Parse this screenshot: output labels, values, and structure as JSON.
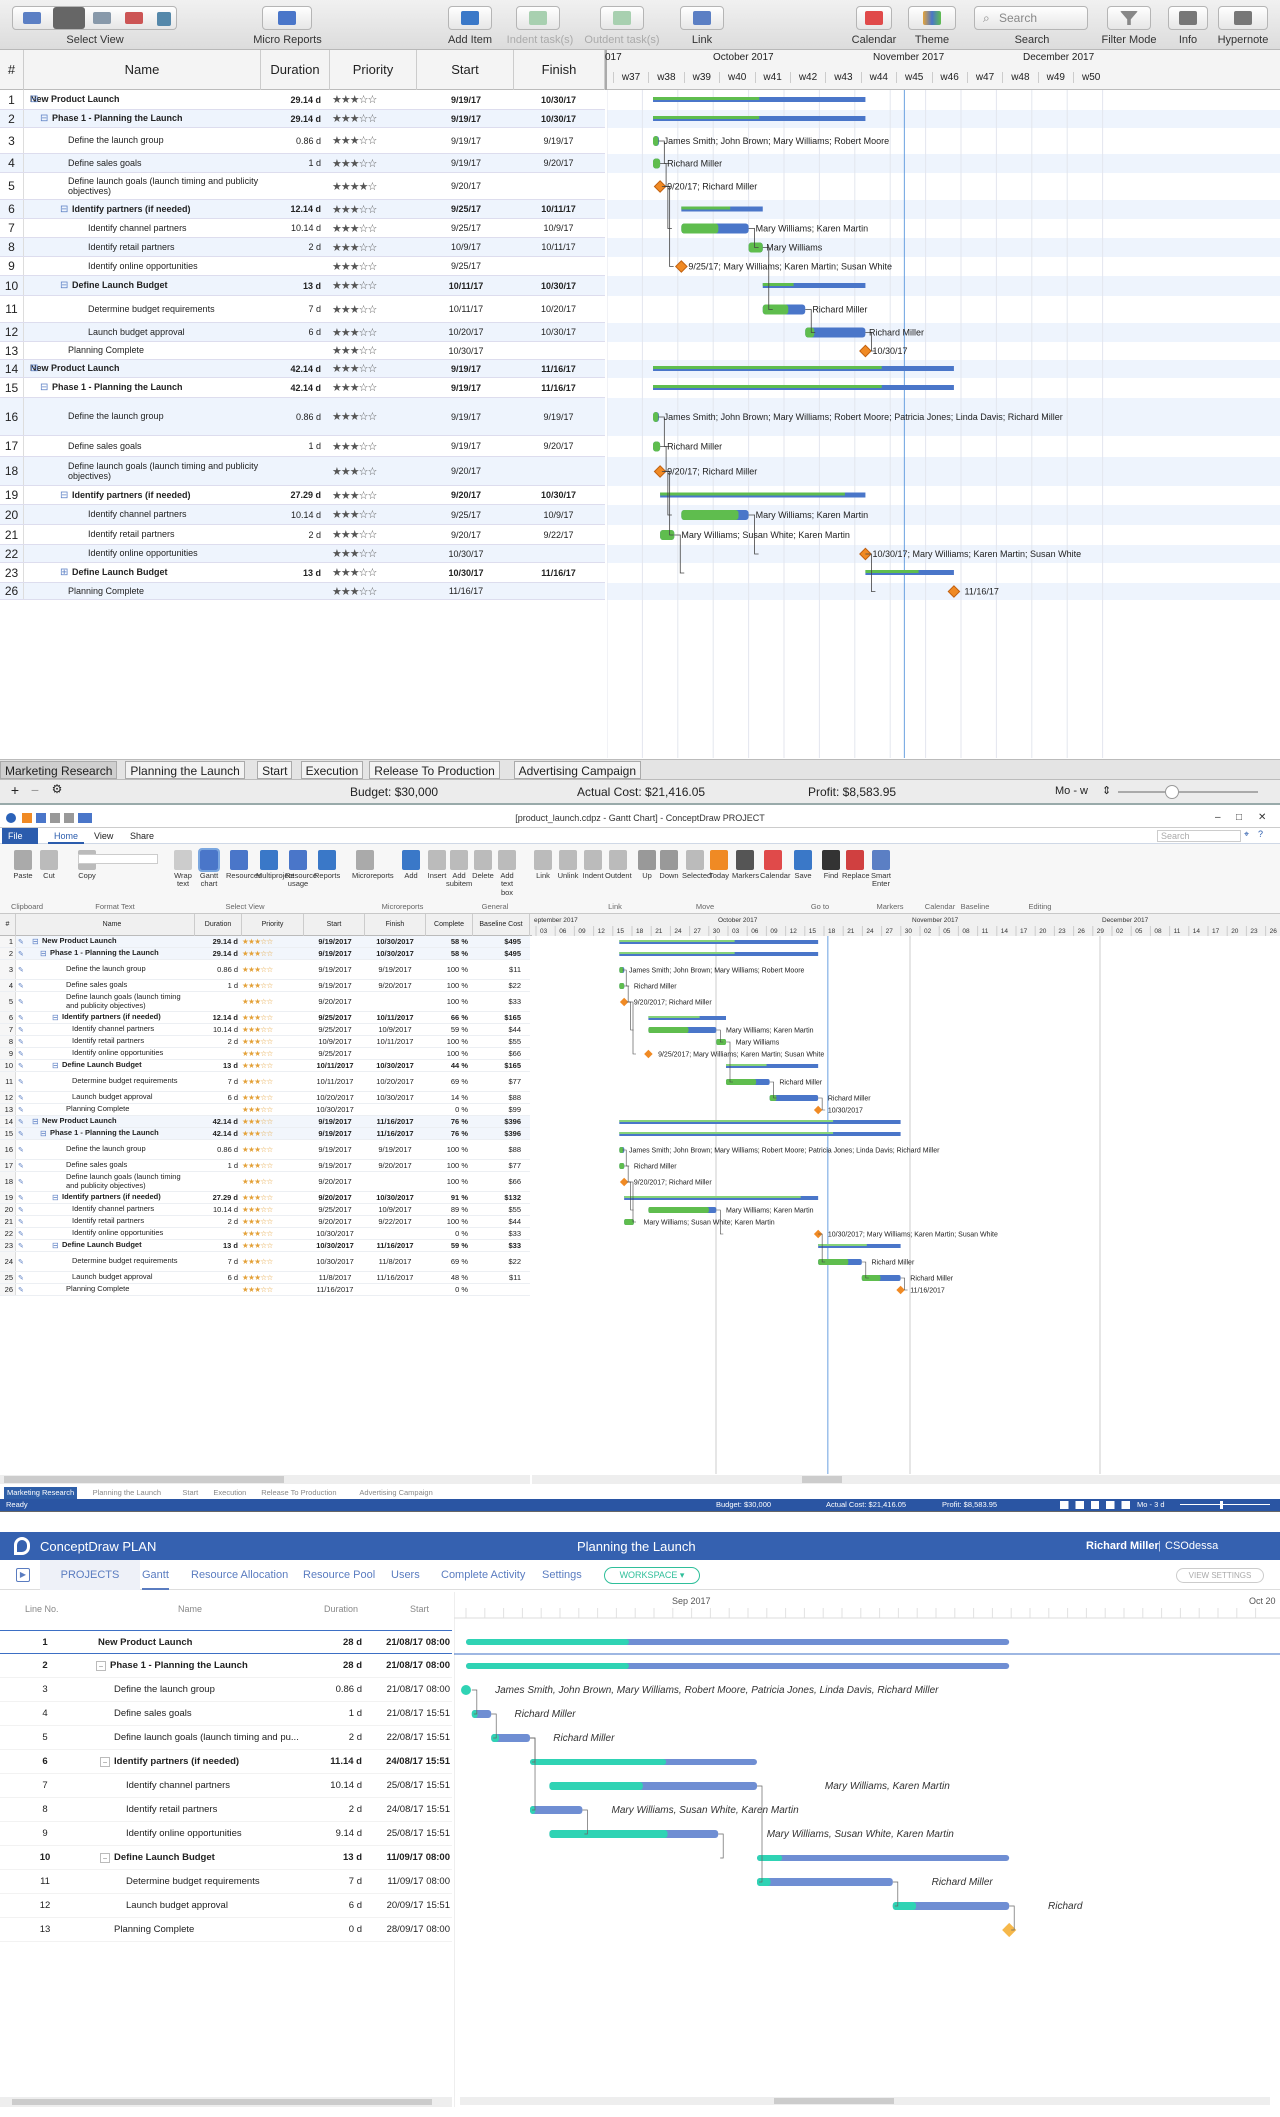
{
  "mac": {
    "toolbar": {
      "select_view": "Select View",
      "micro_reports": "Micro Reports",
      "add_item": "Add Item",
      "indent": "Indent task(s)",
      "outdent": "Outdent task(s)",
      "link": "Link",
      "calendar": "Calendar",
      "theme": "Theme",
      "search": "Search",
      "search_placeholder": "Search",
      "filter_mode": "Filter Mode",
      "info": "Info",
      "hypernote": "Hypernote"
    },
    "columns": {
      "num": "#",
      "name": "Name",
      "duration": "Duration",
      "priority": "Priority",
      "start": "Start",
      "finish": "Finish"
    },
    "months": [
      "017",
      "October 2017",
      "November 2017",
      "December 2017"
    ],
    "weeks": [
      "w37",
      "w38",
      "w39",
      "w40",
      "w41",
      "w42",
      "w43",
      "w44",
      "w45",
      "w46",
      "w47",
      "w48",
      "w49",
      "w50"
    ],
    "rows": [
      {
        "n": "1",
        "name": "New Product Launch",
        "dur": "29.14 d",
        "stars": "★★★☆☆",
        "start": "9/19/17",
        "finish": "10/30/17",
        "lvl": 0,
        "sum": true
      },
      {
        "n": "2",
        "name": "Phase 1 - Planning the Launch",
        "dur": "29.14 d",
        "stars": "★★★☆☆",
        "start": "9/19/17",
        "finish": "10/30/17",
        "lvl": 1,
        "sum": true
      },
      {
        "n": "3",
        "name": "Define the launch group",
        "dur": "0.86 d",
        "stars": "★★★☆☆",
        "start": "9/19/17",
        "finish": "9/19/17",
        "lvl": 2
      },
      {
        "n": "4",
        "name": "Define sales goals",
        "dur": "1 d",
        "stars": "★★★☆☆",
        "start": "9/19/17",
        "finish": "9/20/17",
        "lvl": 2
      },
      {
        "n": "5",
        "name": "Define launch goals (launch timing and publicity objectives)",
        "dur": "",
        "stars": "★★★★☆",
        "start": "9/20/17",
        "finish": "",
        "lvl": 2
      },
      {
        "n": "6",
        "name": "Identify partners (if needed)",
        "dur": "12.14 d",
        "stars": "★★★☆☆",
        "start": "9/25/17",
        "finish": "10/11/17",
        "lvl": 2,
        "sum": true
      },
      {
        "n": "7",
        "name": "Identify channel partners",
        "dur": "10.14 d",
        "stars": "★★★☆☆",
        "start": "9/25/17",
        "finish": "10/9/17",
        "lvl": 3
      },
      {
        "n": "8",
        "name": "Identify retail partners",
        "dur": "2 d",
        "stars": "★★★☆☆",
        "start": "10/9/17",
        "finish": "10/11/17",
        "lvl": 3
      },
      {
        "n": "9",
        "name": "Identify online opportunities",
        "dur": "",
        "stars": "★★★☆☆",
        "start": "9/25/17",
        "finish": "",
        "lvl": 3
      },
      {
        "n": "10",
        "name": "Define Launch Budget",
        "dur": "13 d",
        "stars": "★★★☆☆",
        "start": "10/11/17",
        "finish": "10/30/17",
        "lvl": 2,
        "sum": true
      },
      {
        "n": "11",
        "name": "Determine budget requirements",
        "dur": "7 d",
        "stars": "★★★☆☆",
        "start": "10/11/17",
        "finish": "10/20/17",
        "lvl": 3
      },
      {
        "n": "12",
        "name": "Launch budget approval",
        "dur": "6 d",
        "stars": "★★★☆☆",
        "start": "10/20/17",
        "finish": "10/30/17",
        "lvl": 3
      },
      {
        "n": "13",
        "name": "Planning Complete",
        "dur": "",
        "stars": "★★★☆☆",
        "start": "10/30/17",
        "finish": "",
        "lvl": 2
      },
      {
        "n": "14",
        "name": "New Product Launch",
        "dur": "42.14 d",
        "stars": "★★★☆☆",
        "start": "9/19/17",
        "finish": "11/16/17",
        "lvl": 0,
        "sum": true
      },
      {
        "n": "15",
        "name": "Phase 1 - Planning the Launch",
        "dur": "42.14 d",
        "stars": "★★★☆☆",
        "start": "9/19/17",
        "finish": "11/16/17",
        "lvl": 1,
        "sum": true
      },
      {
        "n": "16",
        "name": "Define the launch group",
        "dur": "0.86 d",
        "stars": "★★★☆☆",
        "start": "9/19/17",
        "finish": "9/19/17",
        "lvl": 2
      },
      {
        "n": "17",
        "name": "Define sales goals",
        "dur": "1 d",
        "stars": "★★★☆☆",
        "start": "9/19/17",
        "finish": "9/20/17",
        "lvl": 2
      },
      {
        "n": "18",
        "name": "Define launch goals (launch timing and publicity objectives)",
        "dur": "",
        "stars": "★★★☆☆",
        "start": "9/20/17",
        "finish": "",
        "lvl": 2
      },
      {
        "n": "19",
        "name": "Identify partners (if needed)",
        "dur": "27.29 d",
        "stars": "★★★☆☆",
        "start": "9/20/17",
        "finish": "10/30/17",
        "lvl": 2,
        "sum": true
      },
      {
        "n": "20",
        "name": "Identify channel partners",
        "dur": "10.14 d",
        "stars": "★★★☆☆",
        "start": "9/25/17",
        "finish": "10/9/17",
        "lvl": 3
      },
      {
        "n": "21",
        "name": "Identify retail partners",
        "dur": "2 d",
        "stars": "★★★☆☆",
        "start": "9/20/17",
        "finish": "9/22/17",
        "lvl": 3
      },
      {
        "n": "22",
        "name": "Identify online opportunities",
        "dur": "",
        "stars": "★★★☆☆",
        "start": "10/30/17",
        "finish": "",
        "lvl": 3
      },
      {
        "n": "23",
        "name": "Define Launch Budget",
        "dur": "13 d",
        "stars": "★★★☆☆",
        "start": "10/30/17",
        "finish": "11/16/17",
        "lvl": 2,
        "sum": true,
        "collapsed": true
      },
      {
        "n": "26",
        "name": "Planning Complete",
        "dur": "",
        "stars": "★★★☆☆",
        "start": "11/16/17",
        "finish": "",
        "lvl": 2
      }
    ],
    "labels": [
      "James Smith; John Brown; Mary Williams; Robert Moore",
      "Richard Miller",
      "9/20/17; Richard Miller",
      "Mary Williams; Karen Martin",
      "Mary Williams",
      "9/25/17; Mary Williams; Karen Martin; Susan White",
      "Richard Miller",
      "Richard Miller",
      "10/30/17",
      "James Smith; John Brown; Mary Williams; Robert Moore; Patricia Jones; Linda Davis; Richard Miller",
      "Richard Miller",
      "9/20/17; Richard Miller",
      "Mary Williams; Karen Martin",
      "Mary Williams; Susan White; Karen Martin",
      "10/30/17; Mary Williams; Karen Martin; Susan White",
      "11/16/17"
    ],
    "tabs": [
      "Marketing Research",
      "Planning the Launch",
      "Start",
      "Execution",
      "Release To Production",
      "Advertising Campaign"
    ],
    "status": {
      "budget": "Budget: $30,000",
      "actual": "Actual Cost: $21,416.05",
      "profit": "Profit: $8,583.95",
      "zoom": "Mo - w"
    }
  },
  "win": {
    "title": "[product_launch.cdpz - Gantt Chart] - ConceptDraw PROJECT",
    "search_placeholder": "Search",
    "menu": [
      "File",
      "Home",
      "View",
      "Share"
    ],
    "ribbon": [
      "Paste",
      "Cut",
      "Copy",
      "Wrap text",
      "Gantt chart",
      "Resources",
      "Multiproject",
      "Resource usage",
      "Reports",
      "Microreports",
      "Add",
      "Insert",
      "Add subitem",
      "Delete",
      "Add text box",
      "Link",
      "Unlink",
      "Indent",
      "Outdent",
      "Up",
      "Down",
      "Selected",
      "Today",
      "Markers",
      "Calendar",
      "Save",
      "Find",
      "Replace",
      "Smart Enter"
    ],
    "groups": [
      "Clipboard",
      "Format Text",
      "Select View",
      "Microreports",
      "General",
      "Link",
      "Move",
      "Go to",
      "Markers",
      "Calendar",
      "Baseline",
      "Editing"
    ],
    "columns": [
      "#",
      "Name",
      "Duration",
      "Priority",
      "Start",
      "Finish",
      "Complete",
      "Baseline Cost"
    ],
    "months": [
      "eptember 2017",
      "October 2017",
      "November 2017",
      "December 2017"
    ],
    "days": [
      "03",
      "06",
      "09",
      "12",
      "15",
      "18",
      "21",
      "24",
      "27",
      "30",
      "03",
      "06",
      "09",
      "12",
      "15",
      "18",
      "21",
      "24",
      "27",
      "30",
      "02",
      "05",
      "08",
      "11",
      "14",
      "17",
      "20",
      "23",
      "26",
      "29",
      "02",
      "05",
      "08",
      "11",
      "14",
      "17",
      "20",
      "23",
      "26"
    ],
    "rows": [
      {
        "n": "1",
        "name": "New Product Launch",
        "dur": "29.14 d",
        "start": "9/19/2017",
        "finish": "10/30/2017",
        "comp": "58 %",
        "cost": "$495",
        "lvl": 0,
        "sum": true
      },
      {
        "n": "2",
        "name": "Phase 1 - Planning the Launch",
        "dur": "29.14 d",
        "start": "9/19/2017",
        "finish": "10/30/2017",
        "comp": "58 %",
        "cost": "$495",
        "lvl": 1,
        "sum": true
      },
      {
        "n": "3",
        "name": "Define the launch group",
        "dur": "0.86 d",
        "start": "9/19/2017",
        "finish": "9/19/2017",
        "comp": "100 %",
        "cost": "$11",
        "lvl": 2
      },
      {
        "n": "4",
        "name": "Define sales goals",
        "dur": "1 d",
        "start": "9/19/2017",
        "finish": "9/20/2017",
        "comp": "100 %",
        "cost": "$22",
        "lvl": 2
      },
      {
        "n": "5",
        "name": "Define launch goals (launch timing and publicity objectives)",
        "dur": "",
        "start": "9/20/2017",
        "finish": "",
        "comp": "100 %",
        "cost": "$33",
        "lvl": 2
      },
      {
        "n": "6",
        "name": "Identify partners (if needed)",
        "dur": "12.14 d",
        "start": "9/25/2017",
        "finish": "10/11/2017",
        "comp": "66 %",
        "cost": "$165",
        "lvl": 2,
        "sum": true
      },
      {
        "n": "7",
        "name": "Identify channel partners",
        "dur": "10.14 d",
        "start": "9/25/2017",
        "finish": "10/9/2017",
        "comp": "59 %",
        "cost": "$44",
        "lvl": 3
      },
      {
        "n": "8",
        "name": "Identify retail partners",
        "dur": "2 d",
        "start": "10/9/2017",
        "finish": "10/11/2017",
        "comp": "100 %",
        "cost": "$55",
        "lvl": 3
      },
      {
        "n": "9",
        "name": "Identify online opportunities",
        "dur": "",
        "start": "9/25/2017",
        "finish": "",
        "comp": "100 %",
        "cost": "$66",
        "lvl": 3
      },
      {
        "n": "10",
        "name": "Define Launch Budget",
        "dur": "13 d",
        "start": "10/11/2017",
        "finish": "10/30/2017",
        "comp": "44 %",
        "cost": "$165",
        "lvl": 2,
        "sum": true
      },
      {
        "n": "11",
        "name": "Determine budget requirements",
        "dur": "7 d",
        "start": "10/11/2017",
        "finish": "10/20/2017",
        "comp": "69 %",
        "cost": "$77",
        "lvl": 3
      },
      {
        "n": "12",
        "name": "Launch budget approval",
        "dur": "6 d",
        "start": "10/20/2017",
        "finish": "10/30/2017",
        "comp": "14 %",
        "cost": "$88",
        "lvl": 3
      },
      {
        "n": "13",
        "name": "Planning Complete",
        "dur": "",
        "start": "10/30/2017",
        "finish": "",
        "comp": "0 %",
        "cost": "$99",
        "lvl": 2
      },
      {
        "n": "14",
        "name": "New Product Launch",
        "dur": "42.14 d",
        "start": "9/19/2017",
        "finish": "11/16/2017",
        "comp": "76 %",
        "cost": "$396",
        "lvl": 0,
        "sum": true
      },
      {
        "n": "15",
        "name": "Phase 1 - Planning the Launch",
        "dur": "42.14 d",
        "start": "9/19/2017",
        "finish": "11/16/2017",
        "comp": "76 %",
        "cost": "$396",
        "lvl": 1,
        "sum": true
      },
      {
        "n": "16",
        "name": "Define the launch group",
        "dur": "0.86 d",
        "start": "9/19/2017",
        "finish": "9/19/2017",
        "comp": "100 %",
        "cost": "$88",
        "lvl": 2
      },
      {
        "n": "17",
        "name": "Define sales goals",
        "dur": "1 d",
        "start": "9/19/2017",
        "finish": "9/20/2017",
        "comp": "100 %",
        "cost": "$77",
        "lvl": 2
      },
      {
        "n": "18",
        "name": "Define launch goals (launch timing and publicity objectives)",
        "dur": "",
        "start": "9/20/2017",
        "finish": "",
        "comp": "100 %",
        "cost": "$66",
        "lvl": 2
      },
      {
        "n": "19",
        "name": "Identify partners (if needed)",
        "dur": "27.29 d",
        "start": "9/20/2017",
        "finish": "10/30/2017",
        "comp": "91 %",
        "cost": "$132",
        "lvl": 2,
        "sum": true
      },
      {
        "n": "20",
        "name": "Identify channel partners",
        "dur": "10.14 d",
        "start": "9/25/2017",
        "finish": "10/9/2017",
        "comp": "89 %",
        "cost": "$55",
        "lvl": 3
      },
      {
        "n": "21",
        "name": "Identify retail partners",
        "dur": "2 d",
        "start": "9/20/2017",
        "finish": "9/22/2017",
        "comp": "100 %",
        "cost": "$44",
        "lvl": 3
      },
      {
        "n": "22",
        "name": "Identify online opportunities",
        "dur": "",
        "start": "10/30/2017",
        "finish": "",
        "comp": "0 %",
        "cost": "$33",
        "lvl": 3
      },
      {
        "n": "23",
        "name": "Define Launch Budget",
        "dur": "13 d",
        "start": "10/30/2017",
        "finish": "11/16/2017",
        "comp": "59 %",
        "cost": "$33",
        "lvl": 2,
        "sum": true
      },
      {
        "n": "24",
        "name": "Determine budget requirements",
        "dur": "7 d",
        "start": "10/30/2017",
        "finish": "11/8/2017",
        "comp": "69 %",
        "cost": "$22",
        "lvl": 3
      },
      {
        "n": "25",
        "name": "Launch budget approval",
        "dur": "6 d",
        "start": "11/8/2017",
        "finish": "11/16/2017",
        "comp": "48 %",
        "cost": "$11",
        "lvl": 3
      },
      {
        "n": "26",
        "name": "Planning Complete",
        "dur": "",
        "start": "11/16/2017",
        "finish": "",
        "comp": "0 %",
        "cost": "",
        "lvl": 2
      }
    ],
    "labels": [
      "James Smith; John Brown; Mary Williams; Robert Moore",
      "Richard Miller",
      "9/20/2017; Richard Miller",
      "Mary Williams; Karen Martin",
      "Mary Williams",
      "9/25/2017; Mary Williams; Karen Martin; Susan White",
      "Richard Miller",
      "Richard Miller",
      "10/30/2017",
      "James Smith; John Brown; Mary Williams; Robert Moore; Patricia Jones; Linda Davis; Richard Miller",
      "Richard Miller",
      "9/20/2017; Richard Miller",
      "Mary Williams; Karen Martin",
      "Mary Williams; Susan White; Karen Martin",
      "10/30/2017; Mary Williams; Karen Martin; Susan White",
      "Richard Miller",
      "Richard Miller",
      "11/16/2017"
    ],
    "tabs": [
      "Marketing Research",
      "Planning the Launch",
      "Start",
      "Execution",
      "Release To Production",
      "Advertising Campaign"
    ],
    "status": {
      "ready": "Ready",
      "budget": "Budget: $30,000",
      "actual": "Actual Cost: $21,416.05",
      "profit": "Profit: $8,583.95",
      "zoom": "Mo - 3 d"
    }
  },
  "web": {
    "app": "ConceptDraw PLAN",
    "project": "Planning the Launch",
    "user": "Richard Miller",
    "org": "CSOdessa",
    "nav": [
      "PROJECTS",
      "Gantt",
      "Resource Allocation",
      "Resource Pool",
      "Users",
      "Complete Activity",
      "Settings"
    ],
    "workspace": "WORKSPACE",
    "view_settings": "VIEW SETTINGS",
    "columns": [
      "Line No.",
      "Name",
      "Duration",
      "Start"
    ],
    "months": [
      "Sep 2017",
      "Oct 20"
    ],
    "rows": [
      {
        "n": "1",
        "name": "New Product Launch",
        "dur": "28 d",
        "start": "21/08/17 08:00",
        "lvl": 0,
        "sum": true
      },
      {
        "n": "2",
        "name": "Phase 1 - Planning the Launch",
        "dur": "28 d",
        "start": "21/08/17 08:00",
        "lvl": 1,
        "sum": true
      },
      {
        "n": "3",
        "name": "Define the launch group",
        "dur": "0.86 d",
        "start": "21/08/17 08:00",
        "lvl": 2
      },
      {
        "n": "4",
        "name": "Define sales goals",
        "dur": "1 d",
        "start": "21/08/17 15:51",
        "lvl": 2
      },
      {
        "n": "5",
        "name": "Define launch goals (launch timing and pu...",
        "dur": "2 d",
        "start": "22/08/17 15:51",
        "lvl": 2
      },
      {
        "n": "6",
        "name": "Identify partners (if needed)",
        "dur": "11.14 d",
        "start": "24/08/17 15:51",
        "lvl": 2,
        "sum": true
      },
      {
        "n": "7",
        "name": "Identify channel partners",
        "dur": "10.14 d",
        "start": "25/08/17 15:51",
        "lvl": 3
      },
      {
        "n": "8",
        "name": "Identify retail partners",
        "dur": "2 d",
        "start": "24/08/17 15:51",
        "lvl": 3
      },
      {
        "n": "9",
        "name": "Identify online opportunities",
        "dur": "9.14 d",
        "start": "25/08/17 15:51",
        "lvl": 3
      },
      {
        "n": "10",
        "name": "Define Launch Budget",
        "dur": "13 d",
        "start": "11/09/17 08:00",
        "lvl": 2,
        "sum": true
      },
      {
        "n": "11",
        "name": "Determine budget requirements",
        "dur": "7 d",
        "start": "11/09/17 08:00",
        "lvl": 3
      },
      {
        "n": "12",
        "name": "Launch budget approval",
        "dur": "6 d",
        "start": "20/09/17 15:51",
        "lvl": 3
      },
      {
        "n": "13",
        "name": "Planning Complete",
        "dur": "0 d",
        "start": "28/09/17 08:00",
        "lvl": 2
      }
    ],
    "labels": [
      "James Smith, John Brown, Mary Williams, Robert Moore, Patricia Jones, Linda Davis, Richard Miller",
      "Richard Miller",
      "Richard Miller",
      "Mary Williams, Karen Martin",
      "Mary Williams, Susan White, Karen Martin",
      "Mary Williams, Susan White, Karen Martin",
      "Richard Miller",
      "Richard"
    ]
  },
  "colors": {
    "green": "#5fbd4e",
    "blue": "#4a76c9",
    "diamond": "#f08a24",
    "sel_blue": "#3d6fc4",
    "teal": "#2fd3b4"
  }
}
